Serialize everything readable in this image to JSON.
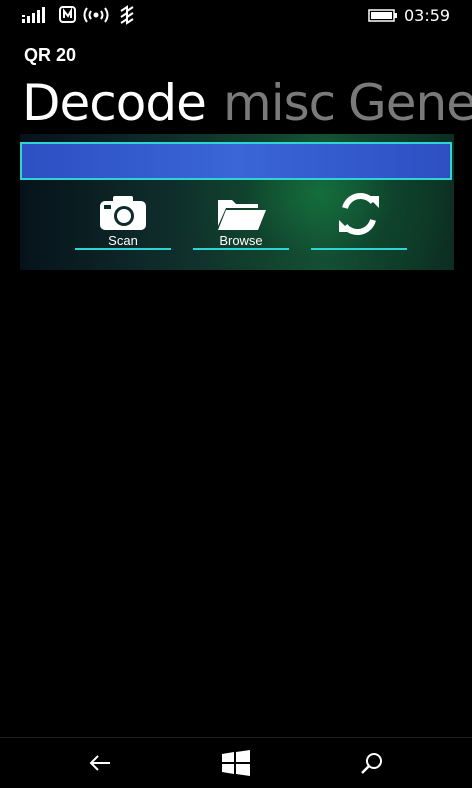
{
  "status_bar": {
    "time": "03:59",
    "icons": [
      "signal-icon",
      "nfc-icon",
      "hotspot-icon",
      "data-icon",
      "battery-icon"
    ]
  },
  "app": {
    "title": "QR 20"
  },
  "pivot": {
    "tabs": [
      {
        "label": "Decode",
        "active": true
      },
      {
        "label": "misc",
        "active": false
      },
      {
        "label": "Gene",
        "active": false
      }
    ]
  },
  "decode_panel": {
    "result_value": "",
    "buttons": [
      {
        "label": "Scan",
        "icon": "camera-icon"
      },
      {
        "label": "Browse",
        "icon": "folder-open-icon"
      },
      {
        "label": "",
        "icon": "refresh-icon"
      }
    ]
  },
  "nav_bar": {
    "icons": [
      "back-arrow-icon",
      "windows-start-icon",
      "search-icon"
    ]
  },
  "colors": {
    "accent": "#2fd4d4",
    "input_fill": "#3a66d8",
    "panel_green": "#1a5a3a",
    "inactive_tab": "#7a7a7a"
  }
}
